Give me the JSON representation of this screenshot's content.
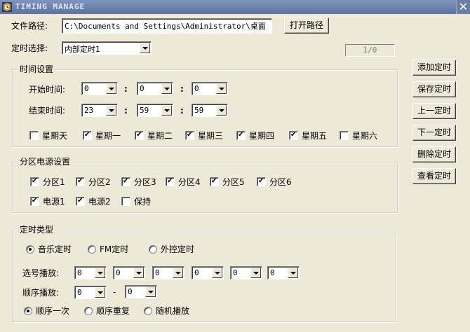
{
  "window": {
    "title": "TIMING MANAGE"
  },
  "path": {
    "label": "文件路径:",
    "value": "C:\\Documents and Settings\\Administrator\\桌面",
    "open_label": "打开路径"
  },
  "timer_select": {
    "label": "定时选择:",
    "value": "内部定时1",
    "counter": "1/0"
  },
  "time_settings": {
    "title": "时间设置",
    "start": {
      "label": "开始时间:",
      "hour": "0",
      "minute": "0",
      "second": "0"
    },
    "end": {
      "label": "结束时间:",
      "hour": "23",
      "minute": "59",
      "second": "59"
    },
    "separator": ":",
    "weekdays": [
      {
        "label": "星期天",
        "checked": false
      },
      {
        "label": "星期一",
        "checked": true
      },
      {
        "label": "星期二",
        "checked": true
      },
      {
        "label": "星期三",
        "checked": true
      },
      {
        "label": "星期四",
        "checked": true
      },
      {
        "label": "星期五",
        "checked": true
      },
      {
        "label": "星期六",
        "checked": false
      }
    ]
  },
  "zone_power": {
    "title": "分区电源设置",
    "zones": [
      {
        "label": "分区1",
        "checked": true
      },
      {
        "label": "分区2",
        "checked": true
      },
      {
        "label": "分区3",
        "checked": true
      },
      {
        "label": "分区4",
        "checked": true
      },
      {
        "label": "分区5",
        "checked": true
      },
      {
        "label": "分区6",
        "checked": true
      }
    ],
    "powers": [
      {
        "label": "电源1",
        "checked": true
      },
      {
        "label": "电源2",
        "checked": true
      },
      {
        "label": "保持",
        "checked": false
      }
    ]
  },
  "timer_type": {
    "title": "定时类型",
    "types": [
      {
        "label": "音乐定时",
        "selected": true
      },
      {
        "label": "FM定时",
        "selected": false
      },
      {
        "label": "外控定时",
        "selected": false
      }
    ],
    "select_play": {
      "label": "选号播放:",
      "values": [
        "0",
        "0",
        "0",
        "0",
        "0",
        "0"
      ]
    },
    "seq_play": {
      "label": "顺序播放:",
      "from": "0",
      "dash": "-",
      "to": "0"
    },
    "modes": [
      {
        "label": "顺序一次",
        "selected": true
      },
      {
        "label": "顺序重复",
        "selected": false
      },
      {
        "label": "随机播放",
        "selected": false
      }
    ]
  },
  "actions": {
    "add": "添加定时",
    "save": "保存定时",
    "prev": "上一定时",
    "next": "下一定时",
    "delete": "删除定时",
    "view": "查看定时"
  }
}
